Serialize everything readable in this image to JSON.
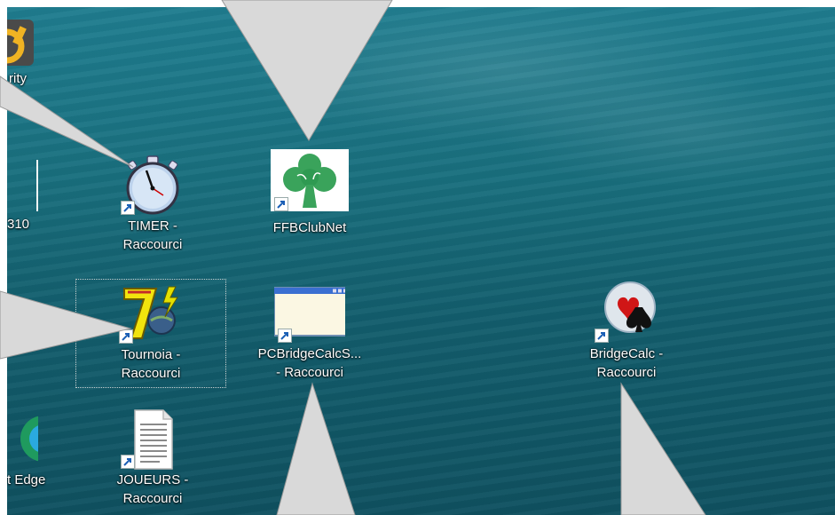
{
  "desktop": {
    "icons": [
      {
        "label": "rity"
      },
      {
        "label": "310"
      },
      {
        "label": "TIMER -\nRaccourci"
      },
      {
        "label": "FFBClubNet"
      },
      {
        "label": "Tournoia -\nRaccourci"
      },
      {
        "label": "PCBridgeCalcS...\n- Raccourci"
      },
      {
        "label": "BridgeCalc -\nRaccourci"
      },
      {
        "label": "t Edge"
      },
      {
        "label": "JOUEURS -\nRaccourci"
      }
    ]
  },
  "icon_names": {
    "security": "security-app-icon",
    "file": "file-icon",
    "timer": "stopwatch-icon",
    "ffb": "tree-icon",
    "tournoia": "tournoia-icon",
    "pcbridge": "window-icon",
    "bridgecalc": "card-suits-icon",
    "edge": "edge-icon",
    "joueurs": "text-document-icon"
  }
}
